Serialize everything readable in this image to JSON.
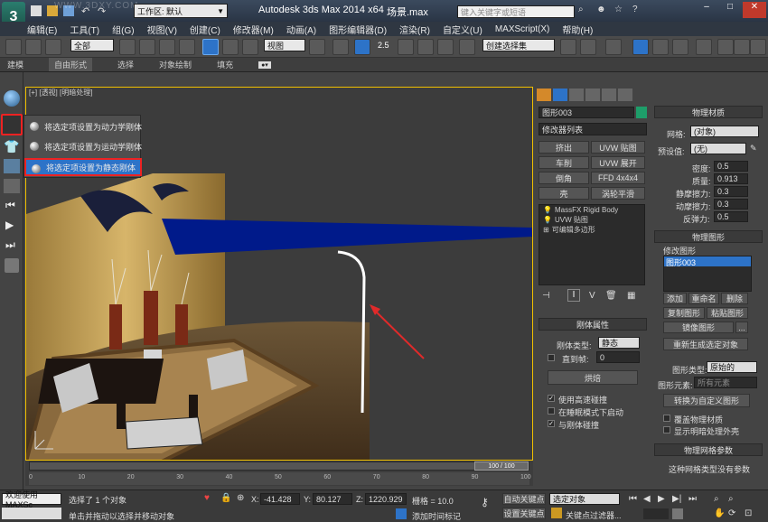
{
  "title_bar": {
    "workspace_label": "工作区: 默认",
    "app_title": "Autodesk 3ds Max  2014 x64",
    "file_name": "场景.max",
    "search_placeholder": "键入关键字或短语",
    "watermark": "WWW.3DXY.COM"
  },
  "menu": [
    "编辑(E)",
    "工具(T)",
    "组(G)",
    "视图(V)",
    "创建(C)",
    "修改器(M)",
    "动画(A)",
    "图形编辑器(D)",
    "渲染(R)",
    "自定义(U)",
    "MAXScript(X)",
    "帮助(H)"
  ],
  "toolbar": {
    "selection_filter": "全部",
    "ref_coord": "视图",
    "snap_value": "2.5",
    "named_selection": "创建选择集"
  },
  "ribbon": [
    "建模",
    "自由形式",
    "选择",
    "对象绘制",
    "填充"
  ],
  "viewport": {
    "label": "[+] [透视] [明暗处理]",
    "frame_counter": "100 / 100"
  },
  "context_menu": {
    "items": [
      "将选定项设置为动力学刚体",
      "将选定项设置为运动学刚体",
      "将选定项设置为静态刚体"
    ],
    "highlighted_index": 2
  },
  "command_panel": {
    "object_name": "图形003",
    "object_color": "#1e9e6a",
    "modifier_list": "修改器列表",
    "modifier_buttons": [
      [
        "挤出",
        "UVW 贴图"
      ],
      [
        "车削",
        "UVW 展开"
      ],
      [
        "倒角",
        "FFD 4x4x4"
      ],
      [
        "壳",
        "涡轮平滑"
      ]
    ],
    "stack": [
      "MassFX Rigid Body",
      "UVW 贴图",
      "可编辑多边形"
    ],
    "rigid_props": {
      "title": "刚体属性",
      "type_label": "刚体类型:",
      "type_value": "静态",
      "until_frame_label": "直到帧:",
      "until_frame_value": "0",
      "bake_button": "烘焙",
      "checks": [
        {
          "label": "使用高速碰撞",
          "checked": true
        },
        {
          "label": "在睡眠模式下启动",
          "checked": false
        },
        {
          "label": "与刚体碰撞",
          "checked": true
        }
      ]
    }
  },
  "right_panel": {
    "physical_material": {
      "title": "物理材质",
      "mesh_label": "网格:",
      "mesh_value": "(对象)",
      "preset_label": "预设值:",
      "preset_value": "(无)",
      "params": [
        {
          "label": "密度:",
          "value": "0.5"
        },
        {
          "label": "质量:",
          "value": "0.913"
        },
        {
          "label": "静摩擦力:",
          "value": "0.3"
        },
        {
          "label": "动摩擦力:",
          "value": "0.3"
        },
        {
          "label": "反弹力:",
          "value": "0.5"
        }
      ]
    },
    "physical_shape": {
      "title": "物理图形",
      "modify_shape_label": "修改图形",
      "list_item": "图形003",
      "buttons": [
        "添加",
        "重命名",
        "删除",
        "复制图形",
        "粘贴图形",
        "镜像图形",
        "...",
        "重新生成选定对象"
      ],
      "shape_type_label": "图形类型:",
      "shape_type_value": "原始的",
      "shape_element_label": "图形元素:",
      "shape_element_value": "所有元素",
      "convert_button": "转换为自定义图形",
      "checks": [
        "覆盖物理材质",
        "显示明暗处理外壳"
      ]
    },
    "mesh_params": {
      "title": "物理网格参数",
      "text": "这种网格类型没有参数"
    }
  },
  "status": {
    "welcome": "欢迎使用 MAXSc",
    "selected": "选择了 1 个对象",
    "hint": "单击并拖动以选择并移动对象",
    "x_label": "X:",
    "x_value": "-41.428",
    "y_label": "Y:",
    "y_value": "80.127",
    "z_label": "Z:",
    "z_value": "1220.929",
    "grid": "栅格 = 10.0",
    "auto_key": "自动关键点",
    "set_key": "设置关键点",
    "selected_obj": "选定对象",
    "key_filter": "关键点过滤器...",
    "add_time_tag": "添加时间标记"
  },
  "timeline_ticks": [
    "0",
    "10",
    "20",
    "30",
    "40",
    "50",
    "60",
    "70",
    "80",
    "90",
    "100"
  ]
}
